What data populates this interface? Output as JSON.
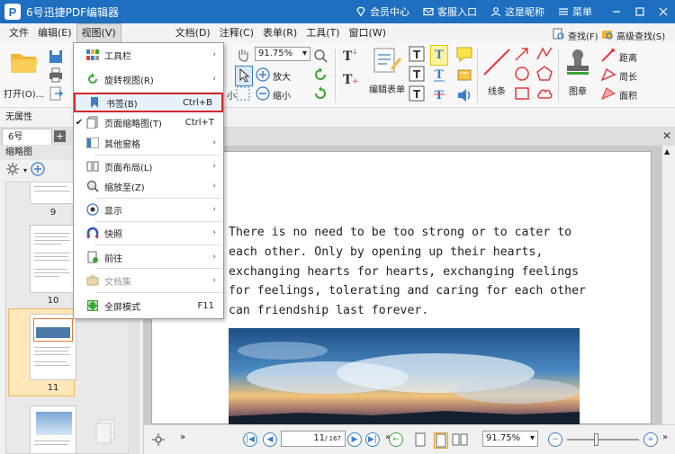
{
  "titlebar": {
    "app_title": "6号迅捷PDF编辑器",
    "member_center": "会员中心",
    "service": "客服入口",
    "nickname": "这是昵称",
    "menu": "菜单"
  },
  "menubar": [
    "文件",
    "编辑(E)",
    "视图(V)",
    "文档(D)",
    "注释(C)",
    "表单(R)",
    "工具(T)",
    "窗口(W)"
  ],
  "ribbon": {
    "open": "打开(O)...",
    "zoom_value": "91.75%",
    "zoom_in": "放大",
    "zoom_out": "缩小",
    "edit_form": "编辑表单",
    "lines": "线条",
    "stamp": "图章",
    "find": "查找(F)",
    "advanced_find": "高级查找(S)",
    "distance": "距离",
    "perimeter": "周长",
    "area": "面积",
    "small_label": "小"
  },
  "propbar": {
    "label": "无属性"
  },
  "doc_tab": {
    "name": "6号"
  },
  "leftpanel": {
    "title": "缩略图",
    "pages": [
      "9",
      "10",
      "11"
    ]
  },
  "document": {
    "paragraph": [
      "There is no need to be too strong or to cater to",
      "each other. Only by opening up their hearts,",
      "exchanging hearts for hearts, exchanging feelings",
      "for feelings, tolerating and caring for each other",
      "can friendship last forever."
    ]
  },
  "statusbar": {
    "page_current": "11",
    "page_total": "/ 167",
    "zoom": "91.75%"
  },
  "dropdown": {
    "items": [
      {
        "label": "工具栏",
        "shortcut": "",
        "arrow": "›",
        "check": ""
      },
      {
        "label": "旋转视图(R)",
        "shortcut": "",
        "arrow": "›",
        "check": ""
      },
      {
        "label": "书签(B)",
        "shortcut": "Ctrl+B",
        "arrow": "",
        "check": ""
      },
      {
        "label": "页面缩略图(T)",
        "shortcut": "Ctrl+T",
        "arrow": "",
        "check": "✔"
      },
      {
        "label": "其他窗格",
        "shortcut": "",
        "arrow": "›",
        "check": ""
      },
      {
        "label": "页面布局(L)",
        "shortcut": "",
        "arrow": "›",
        "check": ""
      },
      {
        "label": "缩放至(Z)",
        "shortcut": "",
        "arrow": "›",
        "check": ""
      },
      {
        "label": "显示",
        "shortcut": "",
        "arrow": "›",
        "check": ""
      },
      {
        "label": "快照",
        "shortcut": "",
        "arrow": "›",
        "check": ""
      },
      {
        "label": "前往",
        "shortcut": "",
        "arrow": "›",
        "check": ""
      },
      {
        "label": "文档集",
        "shortcut": "",
        "arrow": "›",
        "check": ""
      },
      {
        "label": "全屏模式",
        "shortcut": "F11",
        "arrow": "",
        "check": ""
      }
    ]
  },
  "colors": {
    "titlebar": "#1e6fc0",
    "highlight_border": "#d7262c",
    "accent": "#3b7fc8"
  }
}
